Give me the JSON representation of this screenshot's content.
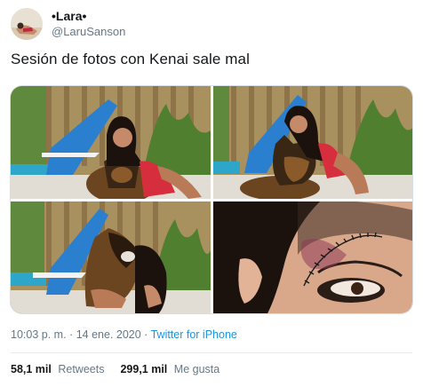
{
  "user": {
    "display_name": "•Lara•",
    "handle": "@LaruSanson"
  },
  "tweet": {
    "text": "Sesión de fotos con Kenai sale mal"
  },
  "media": {
    "photo_count": 4
  },
  "meta": {
    "time": "10:03 p. m.",
    "separator": "·",
    "date": "14 ene. 2020",
    "source": "Twitter for iPhone"
  },
  "stats": {
    "retweets_count": "58,1 mil",
    "retweets_label": "Retweets",
    "likes_count": "299,1 mil",
    "likes_label": "Me gusta"
  },
  "colors": {
    "link_blue": "#1b95e0",
    "muted_gray": "#657786",
    "text_dark": "#14171a"
  }
}
